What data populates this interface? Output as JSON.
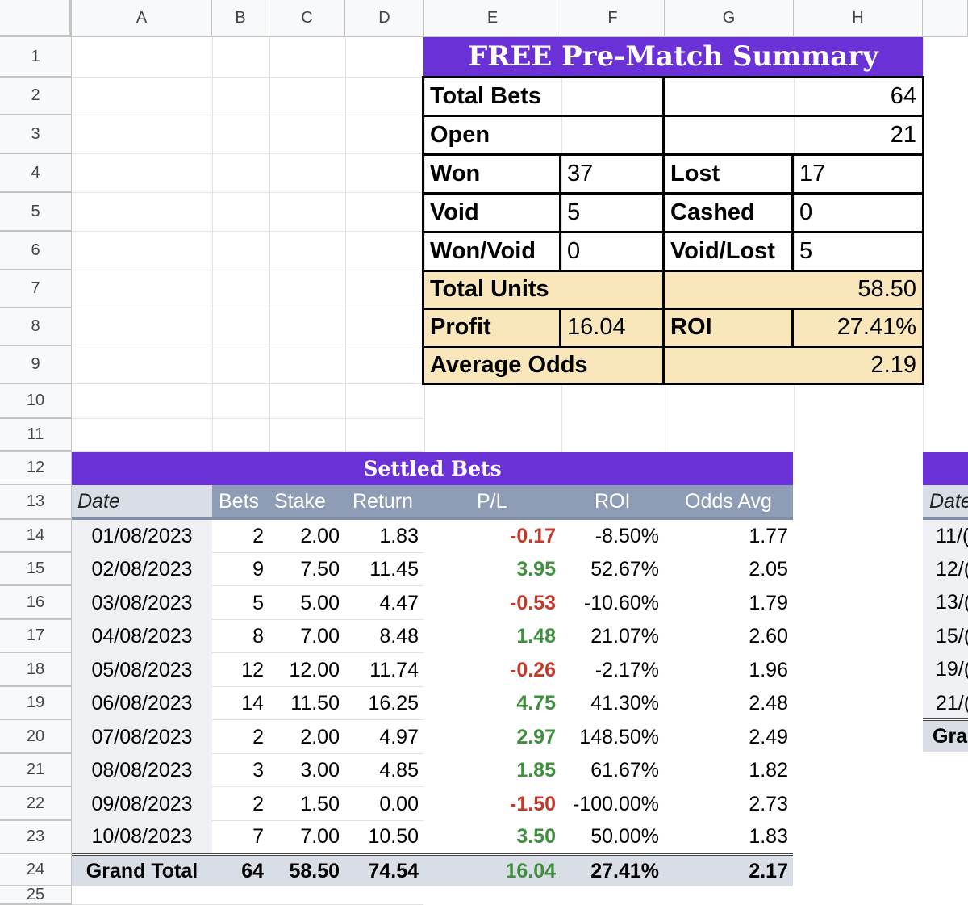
{
  "columns": [
    "A",
    "B",
    "C",
    "D",
    "E",
    "F",
    "G",
    "H"
  ],
  "rows": [
    "1",
    "2",
    "3",
    "4",
    "5",
    "6",
    "7",
    "8",
    "9",
    "10",
    "11",
    "12",
    "13",
    "14",
    "15",
    "16",
    "17",
    "18",
    "19",
    "20",
    "21",
    "22",
    "23",
    "24",
    "25"
  ],
  "summary": {
    "title": "FREE Pre-Match Summary",
    "total_bets_label": "Total Bets",
    "total_bets": "64",
    "open_label": "Open",
    "open": "21",
    "won_label": "Won",
    "won": "37",
    "lost_label": "Lost",
    "lost": "17",
    "void_label": "Void",
    "void": "5",
    "cashed_label": "Cashed",
    "cashed": "0",
    "wonvoid_label": "Won/Void",
    "wonvoid": "0",
    "voidlost_label": "Void/Lost",
    "voidlost": "5",
    "units_label": "Total Units",
    "units": "58.50",
    "profit_label": "Profit",
    "profit": "16.04",
    "roi_label": "ROI",
    "roi": "27.41%",
    "odds_label": "Average Odds",
    "odds": "2.19"
  },
  "settled": {
    "title": "Settled Bets",
    "headers": [
      "Date",
      "Bets",
      "Stake",
      "Return",
      "P/L",
      "ROI",
      "Odds Avg"
    ],
    "rows": [
      [
        "01/08/2023",
        "2",
        "2.00",
        "1.83",
        "-0.17",
        "-8.50%",
        "1.77"
      ],
      [
        "02/08/2023",
        "9",
        "7.50",
        "11.45",
        "3.95",
        "52.67%",
        "2.05"
      ],
      [
        "03/08/2023",
        "5",
        "5.00",
        "4.47",
        "-0.53",
        "-10.60%",
        "1.79"
      ],
      [
        "04/08/2023",
        "8",
        "7.00",
        "8.48",
        "1.48",
        "21.07%",
        "2.60"
      ],
      [
        "05/08/2023",
        "12",
        "12.00",
        "11.74",
        "-0.26",
        "-2.17%",
        "1.96"
      ],
      [
        "06/08/2023",
        "14",
        "11.50",
        "16.25",
        "4.75",
        "41.30%",
        "2.48"
      ],
      [
        "07/08/2023",
        "2",
        "2.00",
        "4.97",
        "2.97",
        "148.50%",
        "2.49"
      ],
      [
        "08/08/2023",
        "3",
        "3.00",
        "4.85",
        "1.85",
        "61.67%",
        "1.82"
      ],
      [
        "09/08/2023",
        "2",
        "1.50",
        "0.00",
        "-1.50",
        "-100.00%",
        "2.73"
      ],
      [
        "10/08/2023",
        "7",
        "7.00",
        "10.50",
        "3.50",
        "50.00%",
        "1.83"
      ]
    ],
    "total": [
      "Grand Total",
      "64",
      "58.50",
      "74.54",
      "16.04",
      "27.41%",
      "2.17"
    ]
  },
  "right_table": {
    "header": "Date",
    "rows": [
      "11/(",
      "12/(",
      "13/(",
      "15/(",
      "19/(",
      "21/("
    ],
    "total": "Gra"
  },
  "colors": {
    "purple": "#6a31d6",
    "header_blue": "#8e9cb5",
    "cream": "#f9e6bb",
    "positive": "#3f8f3f",
    "negative": "#c0392b"
  }
}
